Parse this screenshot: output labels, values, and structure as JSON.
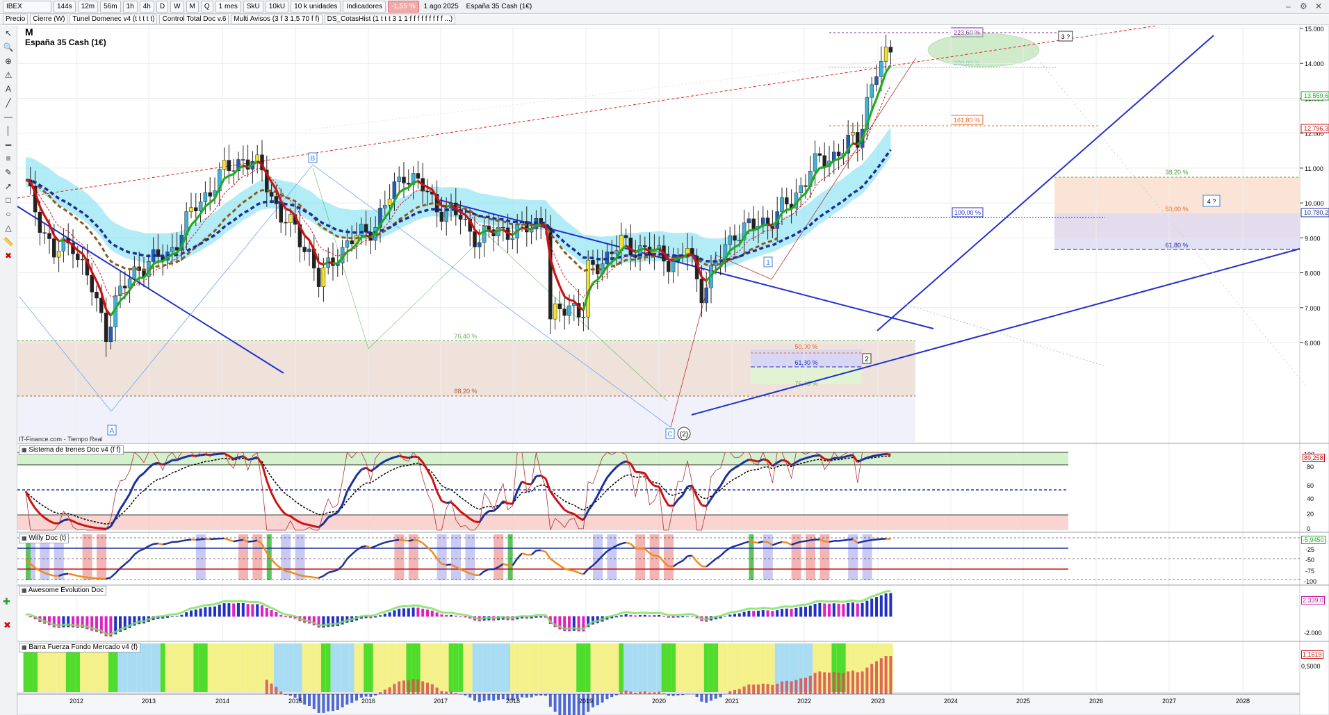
{
  "toolbar": {
    "symbol": "IBEX",
    "timeframes": [
      "144s",
      "12m",
      "56m",
      "1h",
      "4h",
      "D",
      "W",
      "M",
      "Q"
    ],
    "period": "1 mes",
    "sku": "SkU",
    "tenku": "10kU",
    "units": "10 k unidades",
    "indicators": "Indicadores",
    "change": "-1,55 %",
    "date": "1 ago 2025",
    "instrument": "España 35 Cash (1€)"
  },
  "indicator_bar": {
    "items": [
      "Precio",
      "Cierre (W)",
      "Tunel Domenec v4 (t t t t t)",
      "Control Total Doc v.6",
      "Multi Avisos (3 f 3 1,5 70 f f)",
      "DS_CotasHist (1 t t t 3 1 1 f f f f f f f f f ...)"
    ]
  },
  "chart_header": {
    "period_letter": "M",
    "name": "España 35 Cash (1€)",
    "source": "IT-Finance.com - Tiempo Real"
  },
  "colors": {
    "bull": "#1f5fbf",
    "bear": "#222222",
    "ma_green": "#22aa22",
    "ma_red": "#cc1111",
    "ma_brown": "#8b5a1a",
    "ma_navy": "#1a2f9a",
    "trend_blue": "#1f2fd0",
    "cyan": "#7fe0f0"
  },
  "price_axis": {
    "ticks": [
      "15.000",
      "14.000",
      "13.000",
      "12.000",
      "11.000",
      "10.000",
      "9.000",
      "8.000",
      "7.000",
      "6.000"
    ],
    "markers": [
      {
        "label": "13.559,6",
        "color": "#22aa22"
      },
      {
        "label": "12.796,3",
        "color": "#cc1111"
      },
      {
        "label": "10.780,2",
        "color": "#1a2f9a"
      }
    ]
  },
  "time_axis": {
    "years": [
      "2012",
      "2013",
      "2014",
      "2015",
      "2016",
      "2017",
      "2018",
      "2019",
      "2020",
      "2021",
      "2022",
      "2023",
      "2024",
      "2025",
      "2026",
      "2027",
      "2028"
    ]
  },
  "fib_labels": {
    "f223": "223,60 %",
    "f200": "200,00 %",
    "f161": "161,80 %",
    "f100": "100,00 %",
    "f38": "38,20 %",
    "f50": "50,00 %",
    "f618": "61,80 %",
    "f764": "76,40 %",
    "f882": "88,20 %",
    "f50b": "50,00 %",
    "f618b": "61,80 %",
    "f764b": "76,40 %"
  },
  "wave_labels": {
    "A": "A",
    "B": "B",
    "C": "C",
    "C2": "(2)",
    "w1": "1",
    "w2": "2",
    "w3": "3 ?",
    "w4": "4 ?"
  },
  "panels": {
    "trenes": {
      "title": "Sistema de trenes Doc v4 (f f)",
      "ticks": [
        "100",
        "80",
        "60",
        "40",
        "20",
        "0"
      ],
      "value": "89,258"
    },
    "willy": {
      "title": "Willy Doc (t)",
      "ticks": [
        "-25",
        "-50",
        "-75",
        "-100"
      ],
      "value": "-5,9450"
    },
    "awesome": {
      "title": "Awesome Evolution Doc",
      "ticks": [
        "-2.000"
      ],
      "value": "2.339,0"
    },
    "barra": {
      "title": "Barra Fuerza Fondo Mercado v4 (f)",
      "ticks": [
        "0,5000"
      ],
      "value": "1,1619"
    }
  }
}
